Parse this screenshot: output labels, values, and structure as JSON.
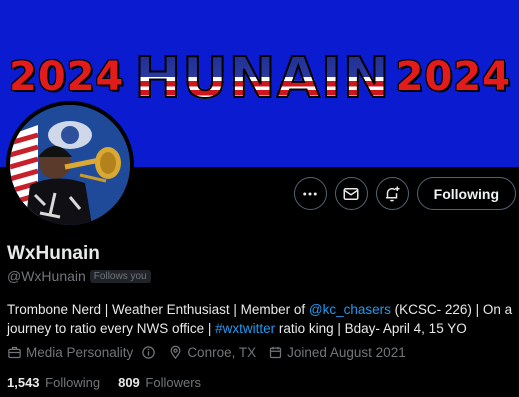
{
  "banner": {
    "year_left": "2024",
    "name_text": "HUNAIN",
    "year_right": "2024",
    "colors": {
      "background": "#0a1bd0",
      "year": "#e21b1b"
    }
  },
  "actions": {
    "more_icon": "ellipsis-icon",
    "message_icon": "envelope-icon",
    "notify_icon": "bell-plus-icon",
    "following_label": "Following"
  },
  "profile": {
    "display_name": "WxHunain",
    "handle": "@WxHunain",
    "follows_you": "Follows you"
  },
  "bio": {
    "part1": "Trombone Nerd | Weather Enthusiast | Member of ",
    "mention": "@kc_chasers",
    "part2": " (KCSC- 226) | On a journey to ratio every NWS office | ",
    "hashtag": "#wxtwitter",
    "part3": " ratio king | Bday- April 4, 15 YO"
  },
  "meta": {
    "category": "Media Personality",
    "location": "Conroe, TX",
    "joined": "Joined August 2021"
  },
  "stats": {
    "following_count": "1,543",
    "following_label": "Following",
    "followers_count": "809",
    "followers_label": "Followers"
  },
  "colors": {
    "accent": "#1d9bf0",
    "muted": "#71767b",
    "text": "#e7e9ea"
  }
}
